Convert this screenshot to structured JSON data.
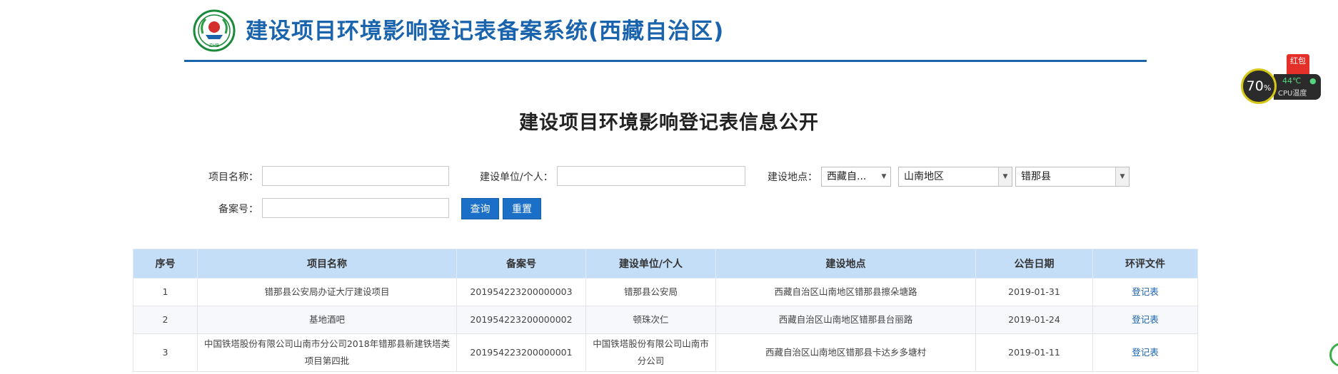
{
  "header": {
    "title": "建设项目环境影响登记表备案系统(西藏自治区)",
    "logo_text": "ZHB"
  },
  "page_heading": "建设项目环境影响登记表信息公开",
  "search": {
    "project_name_label": "项目名称：",
    "project_name_value": "",
    "builder_label": "建设单位/个人：",
    "builder_value": "",
    "location_label": "建设地点：",
    "region_value": "西藏自...",
    "prefecture_value": "山南地区",
    "county_value": "错那县",
    "record_no_label": "备案号：",
    "record_no_value": "",
    "query_button": "查询",
    "reset_button": "重置"
  },
  "table": {
    "headers": [
      "序号",
      "项目名称",
      "备案号",
      "建设单位/个人",
      "建设地点",
      "公告日期",
      "环评文件"
    ],
    "rows": [
      {
        "no": "1",
        "name": "错那县公安局办证大厅建设项目",
        "record": "201954223200000003",
        "builder": "错那县公安局",
        "location": "西藏自治区山南地区错那县擦朵塘路",
        "date": "2019-01-31",
        "file": "登记表"
      },
      {
        "no": "2",
        "name": "基地酒吧",
        "record": "201954223200000002",
        "builder": "顿珠次仁",
        "location": "西藏自治区山南地区错那县台丽路",
        "date": "2019-01-24",
        "file": "登记表"
      },
      {
        "no": "3",
        "name": "中国铁塔股份有限公司山南市分公司2018年错那县新建铁塔类项目第四批",
        "record": "201954223200000001",
        "builder": "中国铁塔股份有限公司山南市分公司",
        "location": "西藏自治区山南地区错那县卡达乡多塘村",
        "date": "2019-01-11",
        "file": "登记表"
      }
    ]
  },
  "widget": {
    "cpu_percent": "70",
    "percent_sign": "%",
    "temperature": "44℃",
    "cpu_label": "CPU温度",
    "red_packet": "红包"
  },
  "colors": {
    "brand": "#1a63ad",
    "button": "#1b6fc6",
    "table_header": "#c5def7"
  }
}
